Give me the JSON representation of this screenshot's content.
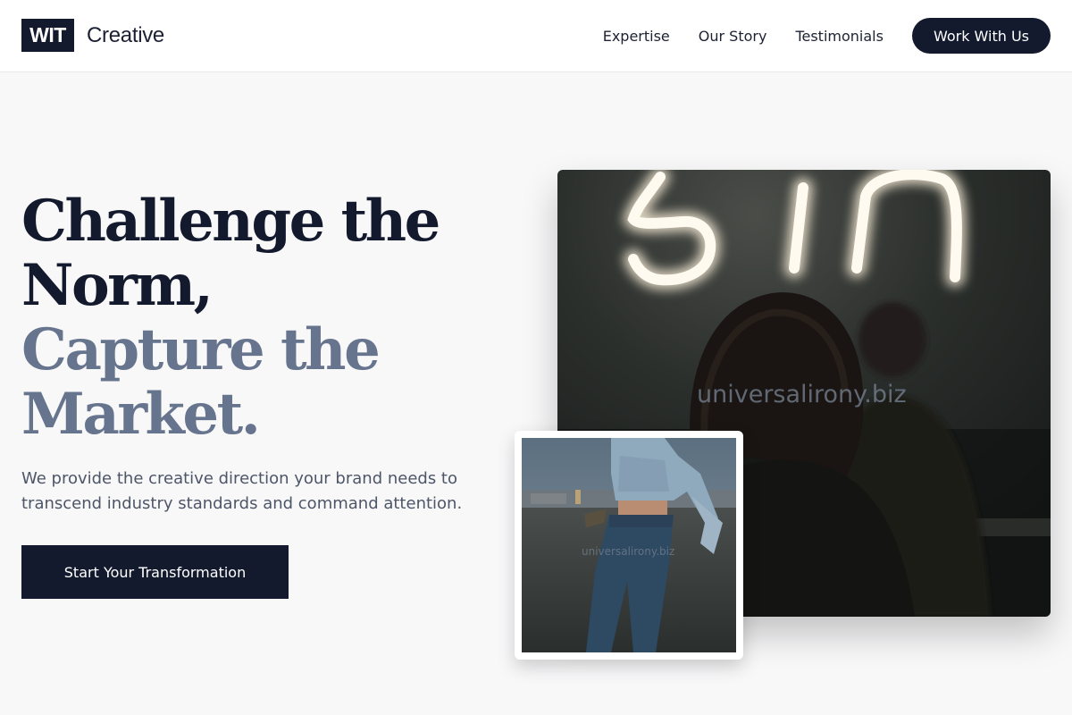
{
  "header": {
    "logo_mark": "WIT",
    "logo_text": "Creative",
    "nav": {
      "expertise": "Expertise",
      "story": "Our Story",
      "testimonials": "Testimonials",
      "cta": "Work With Us"
    }
  },
  "hero": {
    "headline_line1": "Challenge the",
    "headline_line2": "Norm,",
    "headline_line3": "Capture the",
    "headline_line4": "Market.",
    "subtext": "We provide the creative direction your brand needs to transcend industry standards and command attention.",
    "cta": "Start Your Transformation"
  },
  "images": {
    "main_watermark": "universalirony.biz",
    "thumb_watermark": "universalirony.biz"
  },
  "colors": {
    "primary": "#141a2e",
    "muted_heading": "#67748e",
    "body_text": "#4d5568",
    "background": "#f8f8f9"
  }
}
